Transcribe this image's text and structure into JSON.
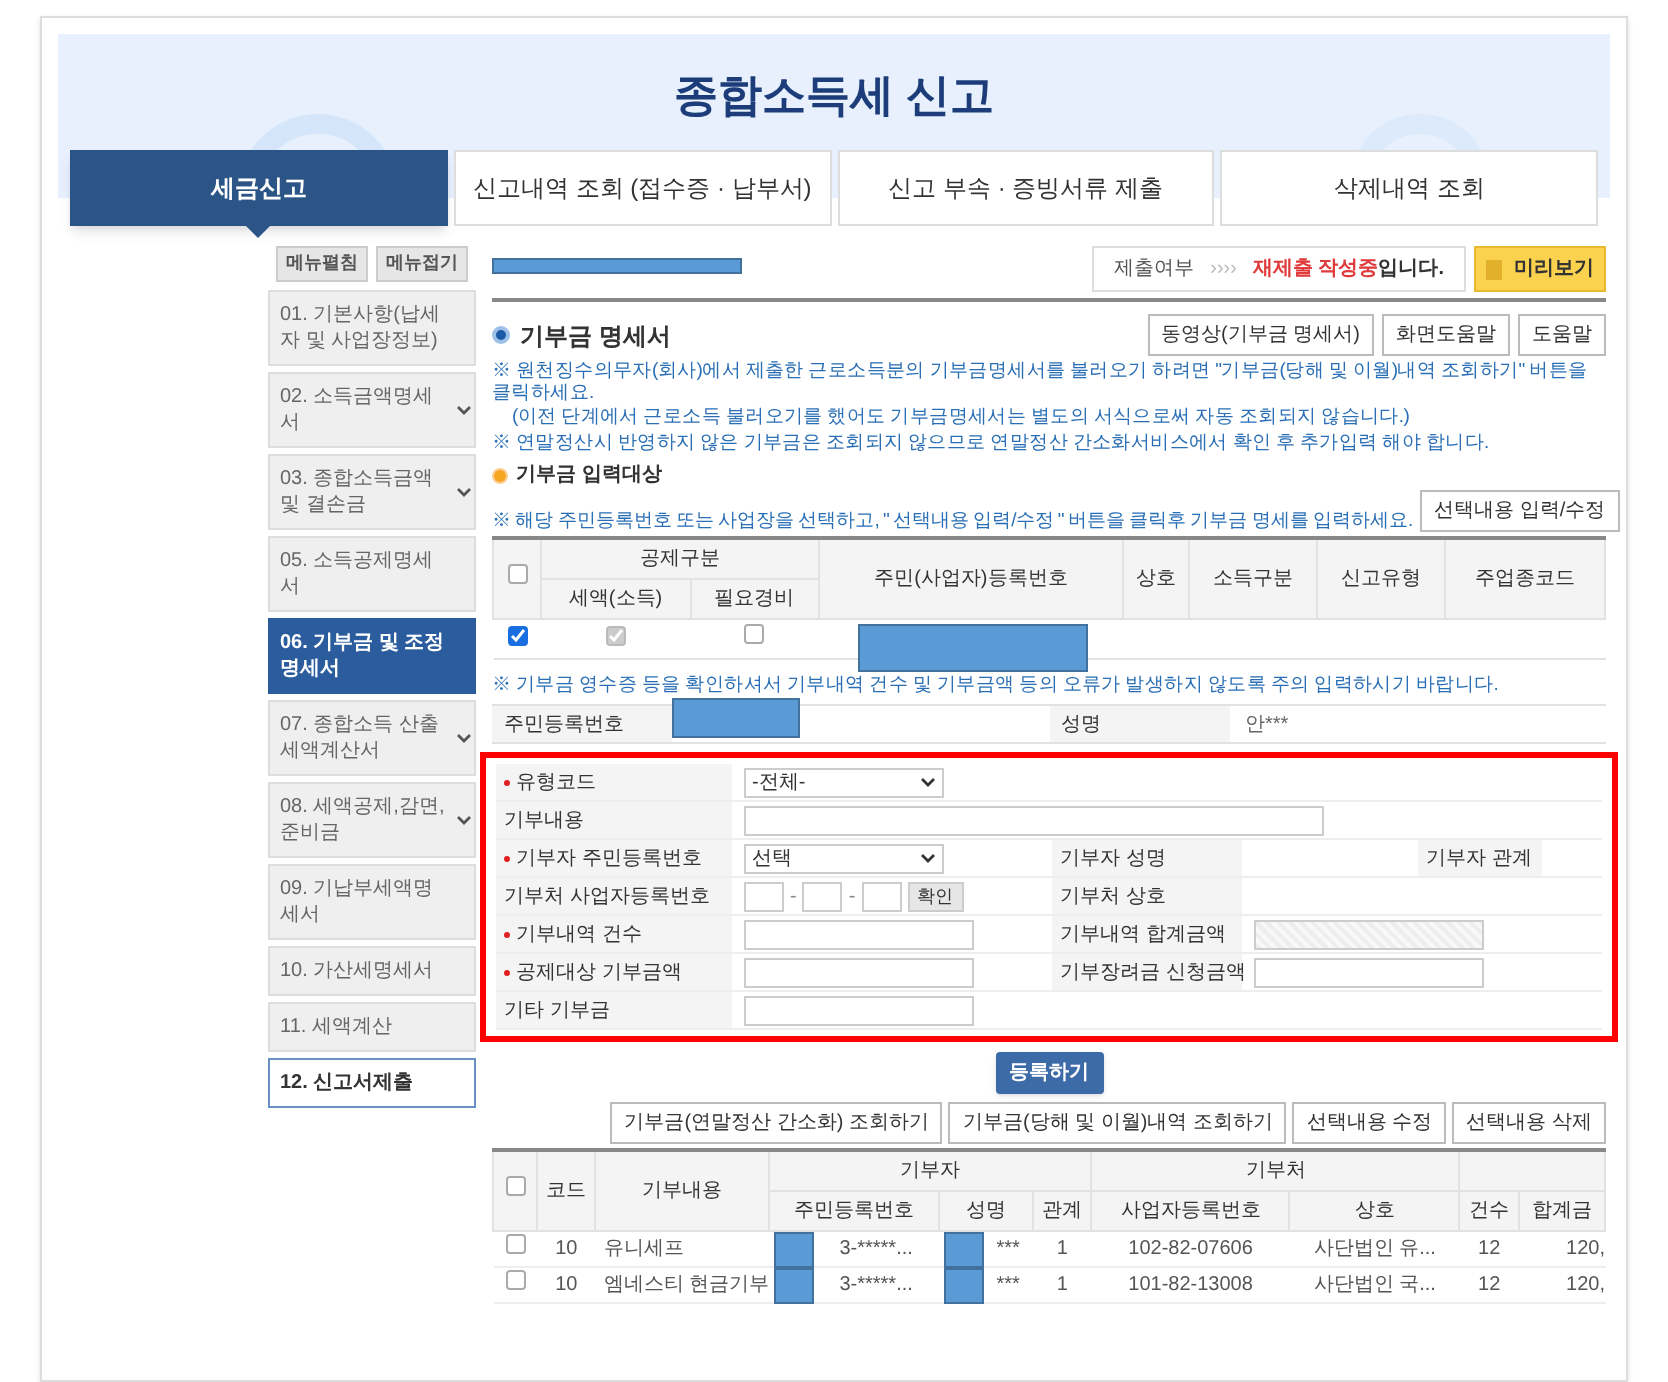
{
  "title": "종합소득세 신고",
  "tabs": [
    {
      "label": "세금신고",
      "selected": true
    },
    {
      "label": "신고내역 조회 (접수증 · 납부서)",
      "selected": false
    },
    {
      "label": "신고 부속 · 증빙서류 제출",
      "selected": false
    },
    {
      "label": "삭제내역 조회",
      "selected": false
    }
  ],
  "sidebar": {
    "buttons": [
      "메뉴펼침",
      "메뉴접기"
    ],
    "items": [
      {
        "label": "01. 기본사항(납세자 및 사업장정보)",
        "selected": false,
        "expandable": false,
        "outlined": false
      },
      {
        "label": "02. 소득금액명세서",
        "selected": false,
        "expandable": true,
        "outlined": false
      },
      {
        "label": "03. 종합소득금액 및 결손금",
        "selected": false,
        "expandable": true,
        "outlined": false
      },
      {
        "label": "05. 소득공제명세서",
        "selected": false,
        "expandable": false,
        "outlined": false
      },
      {
        "label": "06. 기부금 및 조정명세서",
        "selected": true,
        "expandable": false,
        "outlined": false
      },
      {
        "label": "07. 종합소득 산출세액계산서",
        "selected": false,
        "expandable": true,
        "outlined": false
      },
      {
        "label": "08. 세액공제,감면,준비금",
        "selected": false,
        "expandable": true,
        "outlined": false
      },
      {
        "label": "09. 기납부세액명세서",
        "selected": false,
        "expandable": false,
        "outlined": false
      },
      {
        "label": "10. 가산세명세서",
        "selected": false,
        "expandable": false,
        "outlined": false
      },
      {
        "label": "11. 세액계산",
        "selected": false,
        "expandable": false,
        "outlined": false
      },
      {
        "label": "12. 신고서제출",
        "selected": false,
        "expandable": false,
        "outlined": true
      }
    ]
  },
  "header_redacted": true,
  "status": {
    "label": "제출여부",
    "arrows": "››››",
    "value": "재제출 작성중",
    "suffix": "입니다.",
    "preview_button": "미리보기"
  },
  "section": {
    "title": "기부금 명세서",
    "buttons": [
      "동영상(기부금 명세서)",
      "화면도움말",
      "도움말"
    ]
  },
  "notes": [
    "※ 원천징수의무자(회사)에서 제출한 근로소득분의 기부금명세서를 불러오기 하려면 \"기부금(당해 및 이월)내역 조회하기\" 버튼을 클릭하세요.",
    "(이전 단계에서 근로소득 불러오기를 했어도 기부금명세서는 별도의 서식으로써 자동 조회되지 않습니다.)",
    "※ 연말정산시 반영하지 않은 기부금은 조회되지 않으므로 연말정산 간소화서비스에서 확인 후 추가입력 해야 합니다."
  ],
  "target": {
    "title": "기부금 입력대상",
    "note": "※ 해당 주민등록번호 또는 사업장을 선택하고, \" 선택내용 입력/수정 \" 버튼을 클릭후 기부금 명세를 입력하세요.",
    "button": "선택내용 입력/수정",
    "all_checked": false,
    "group": "공제구분",
    "subcolumns": [
      "세액(소득)",
      "필요경비"
    ],
    "columns": [
      "주민(사업자)등록번호",
      "상호",
      "소득구분",
      "신고유형",
      "주업종코드"
    ],
    "rows": [
      {
        "checked": true,
        "tax_credit": true,
        "expense": false,
        "id_redacted": true
      }
    ]
  },
  "note2": "※ 기부금 영수증 등을 확인하셔서 기부내역 건수 및 기부금액 등의 오류가 발생하지 않도록 주의 입력하시기 바랍니다.",
  "info": {
    "id_label": "주민등록번호",
    "id_redacted": true,
    "name_label": "성명",
    "name": "안***"
  },
  "form": [
    [
      {
        "label": "유형코드",
        "required": true,
        "kind": "select",
        "value": "-전체-"
      }
    ],
    [
      {
        "label": "기부내용",
        "required": false,
        "kind": "wide"
      }
    ],
    [
      {
        "label": "기부자 주민등록번호",
        "required": true,
        "kind": "select",
        "value": "선택"
      },
      {
        "label": "기부자 성명",
        "required": false,
        "kind": "blank"
      },
      {
        "label": "기부자 관계",
        "required": false,
        "kind": "blank"
      }
    ],
    [
      {
        "label": "기부처 사업자등록번호",
        "required": false,
        "kind": "bizno",
        "separator": "-",
        "button": "확인"
      },
      {
        "label": "기부처 상호",
        "required": false,
        "kind": "blank"
      }
    ],
    [
      {
        "label": "기부내역 건수",
        "required": true,
        "kind": "text"
      },
      {
        "label": "기부내역 합계금액",
        "required": false,
        "kind": "text",
        "disabled": true
      }
    ],
    [
      {
        "label": "공제대상 기부금액",
        "required": true,
        "kind": "text"
      },
      {
        "label": "기부장려금 신청금액",
        "required": false,
        "kind": "text",
        "disabled": false
      }
    ],
    [
      {
        "label": "기타 기부금",
        "required": false,
        "kind": "text"
      }
    ]
  ],
  "register_button": "등록하기",
  "list_buttons": [
    "기부금(연말정산 간소화) 조회하기",
    "기부금(당해 및 이월)내역 조회하기",
    "선택내용 수정",
    "선택내용 삭제"
  ],
  "list": {
    "all_checked": false,
    "code": "코드",
    "content": "기부내용",
    "donor": "기부자",
    "donor_columns": [
      "주민등록번호",
      "성명",
      "관계"
    ],
    "org": "기부처",
    "org_columns": [
      "사업자등록번호",
      "상호"
    ],
    "extra_columns": [
      "건수",
      "합계금"
    ],
    "rows": [
      {
        "checked": false,
        "cells": [
          "10",
          "유니세프",
          "3-*****...",
          "***",
          "1",
          "102-82-07606",
          "사단법인 유...",
          "12",
          "120,"
        ],
        "redacted": true
      },
      {
        "checked": false,
        "cells": [
          "10",
          "엠네스티 현금기부",
          "3-*****...",
          "***",
          "1",
          "101-82-13008",
          "사단법인 국...",
          "12",
          "120,"
        ],
        "redacted": true
      }
    ]
  }
}
